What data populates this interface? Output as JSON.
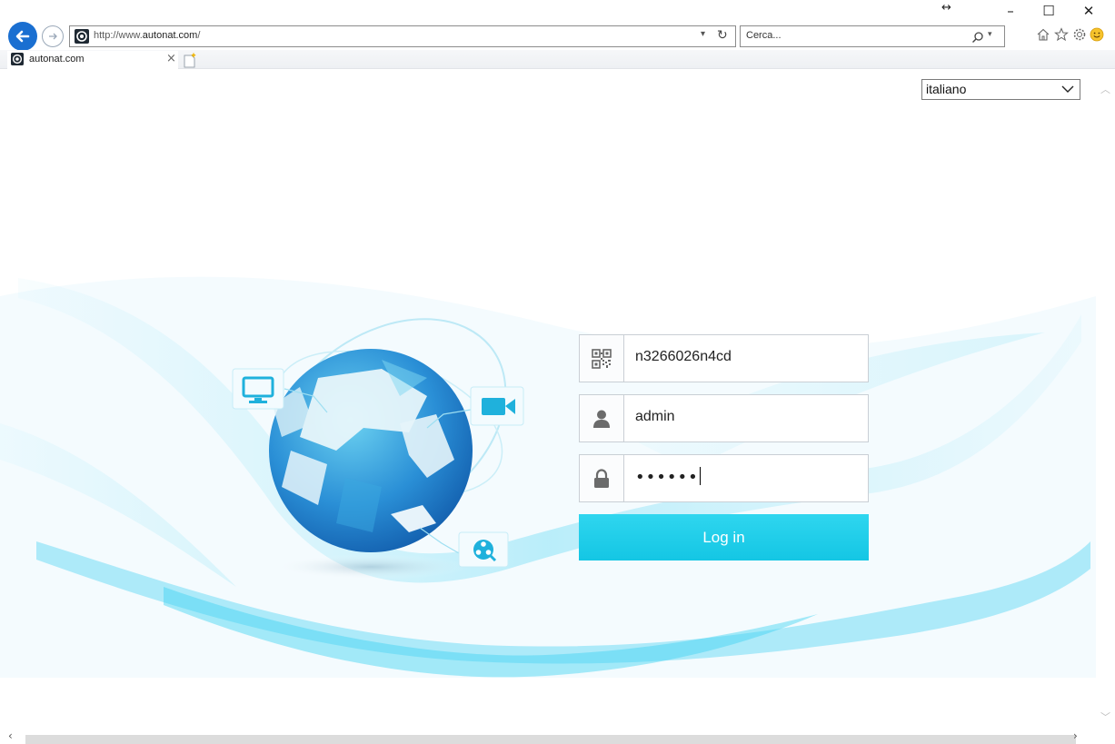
{
  "browser": {
    "url_prefix": "http://www.",
    "url_domain": "autonat.com",
    "url_suffix": "/",
    "search_placeholder": "Cerca...",
    "tab_title": "autonat.com",
    "window_controls": {
      "minimize": "–",
      "maximize": "☐",
      "close": "✕"
    }
  },
  "page": {
    "language": {
      "selected": "italiano"
    },
    "login": {
      "device_id": "n3266026n4cd",
      "username": "admin",
      "password_mask": "••••••",
      "login_label": "Log in"
    }
  },
  "colors": {
    "accent": "#18c9e6",
    "browser_back": "#1a6fd1"
  },
  "icons": {
    "field_device": "qr-code-icon",
    "field_user": "user-icon",
    "field_password": "lock-icon",
    "hero": [
      "monitor-icon",
      "video-camera-icon",
      "film-reel-icon",
      "globe-illustration"
    ]
  }
}
